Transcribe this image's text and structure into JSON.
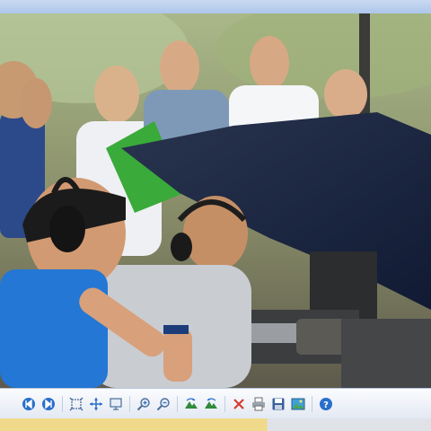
{
  "viewer": {
    "photo_description_icon": "photo"
  },
  "toolbar": {
    "buttons": [
      {
        "icon": "previous-icon"
      },
      {
        "icon": "next-icon"
      },
      {
        "icon": "actual-size-icon"
      },
      {
        "icon": "best-fit-icon"
      },
      {
        "icon": "slideshow-icon"
      },
      {
        "icon": "zoom-in-icon"
      },
      {
        "icon": "zoom-out-icon"
      },
      {
        "icon": "rotate-clockwise-icon"
      },
      {
        "icon": "rotate-counterclockwise-icon"
      },
      {
        "icon": "delete-icon"
      },
      {
        "icon": "print-icon"
      },
      {
        "icon": "save-icon"
      },
      {
        "icon": "open-with-icon"
      },
      {
        "icon": "help-icon"
      }
    ]
  },
  "colors": {
    "accent": "#2a6fc9",
    "delete": "#d63a2f"
  }
}
